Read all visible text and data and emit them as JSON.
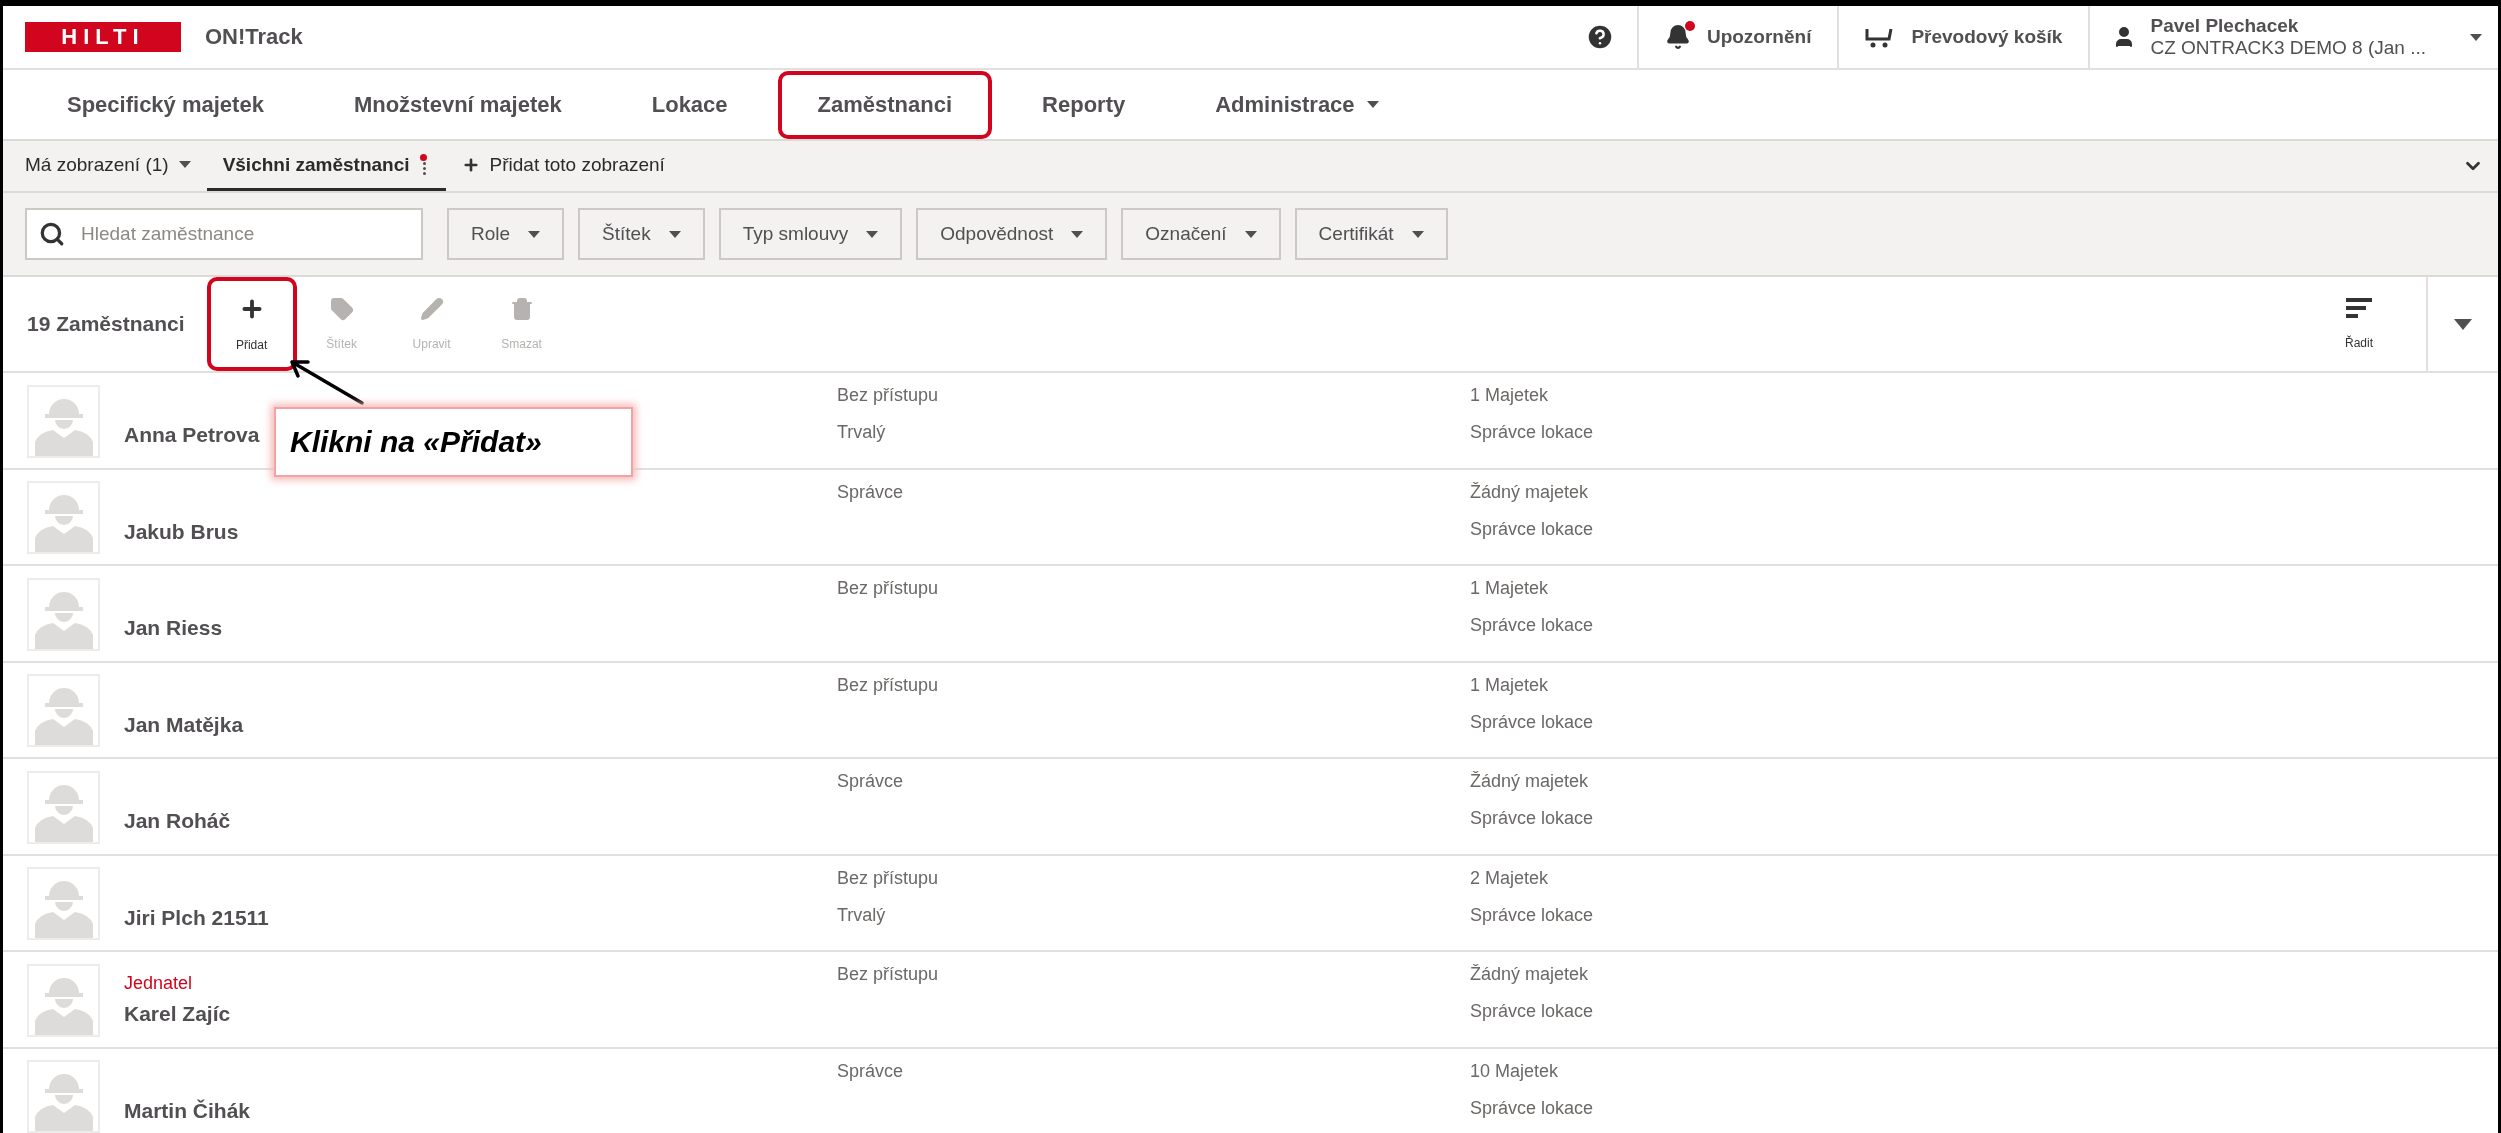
{
  "header": {
    "logo": "HILTI",
    "app_name": "ON!Track",
    "notifications": {
      "label": "Upozornění",
      "unread": true
    },
    "cart": {
      "label": "Převodový košík"
    },
    "user": {
      "name": "Pavel Plechacek",
      "org": "CZ ONTRACK3 DEMO 8 (Jan ..."
    }
  },
  "nav": [
    {
      "label": "Specifický majetek",
      "highlighted": false,
      "dropdown": false
    },
    {
      "label": "Množstevní majetek",
      "highlighted": false,
      "dropdown": false
    },
    {
      "label": "Lokace",
      "highlighted": false,
      "dropdown": false
    },
    {
      "label": "Zaměstnanci",
      "highlighted": true,
      "dropdown": false
    },
    {
      "label": "Reporty",
      "highlighted": false,
      "dropdown": false
    },
    {
      "label": "Administrace",
      "highlighted": false,
      "dropdown": true
    }
  ],
  "views": [
    {
      "kind": "dropdown",
      "label": "Má zobrazení (1)",
      "selected": false
    },
    {
      "kind": "view",
      "label": "Všichni zaměstnanci",
      "selected": true,
      "modified": true
    },
    {
      "kind": "add",
      "label": "Přidat toto zobrazení",
      "selected": false
    }
  ],
  "search": {
    "placeholder": "Hledat zaměstnance"
  },
  "filters": [
    "Role",
    "Štítek",
    "Typ smlouvy",
    "Odpovědnost",
    "Označení",
    "Certifikát"
  ],
  "toolbar": {
    "count": "19 Zaměstnanci",
    "actions": [
      {
        "kind": "add",
        "label": "Přidat",
        "disabled": false,
        "highlighted": true
      },
      {
        "kind": "tag",
        "label": "Štítek",
        "disabled": true,
        "highlighted": false
      },
      {
        "kind": "edit",
        "label": "Upravit",
        "disabled": true,
        "highlighted": false
      },
      {
        "kind": "delete",
        "label": "Smazat",
        "disabled": true,
        "highlighted": false
      }
    ],
    "sort": "Řadit"
  },
  "rows": [
    {
      "name": "Anna Petrova",
      "column_2": [
        "Bez přístupu",
        "Trvalý"
      ],
      "column_3": [
        "1 Majetek",
        "Správce lokace"
      ]
    },
    {
      "name": "Jakub Brus",
      "column_2": [
        "Správce"
      ],
      "column_3": [
        "Žádný majetek",
        "Správce lokace"
      ]
    },
    {
      "name": "Jan Riess",
      "column_2": [
        "Bez přístupu"
      ],
      "column_3": [
        "1 Majetek",
        "Správce lokace"
      ]
    },
    {
      "name": "Jan Matějka",
      "column_2": [
        "Bez přístupu"
      ],
      "column_3": [
        "1 Majetek",
        "Správce lokace"
      ]
    },
    {
      "name": "Jan Roháč",
      "column_2": [
        "Správce"
      ],
      "column_3": [
        "Žádný majetek",
        "Správce lokace"
      ]
    },
    {
      "name": "Jiri Plch 21511",
      "column_2": [
        "Bez přístupu",
        "Trvalý"
      ],
      "column_3": [
        "2 Majetek",
        "Správce lokace"
      ]
    },
    {
      "name": "Karel Zajíc",
      "tag": "Jednatel",
      "column_2": [
        "Bez přístupu"
      ],
      "column_3": [
        "Žádný majetek",
        "Správce lokace"
      ]
    },
    {
      "name": "Martin Čihák",
      "column_2": [
        "Správce"
      ],
      "column_3": [
        "10 Majetek",
        "Správce lokace"
      ]
    }
  ],
  "callout": {
    "text": "Klikni na «Přidat»"
  }
}
